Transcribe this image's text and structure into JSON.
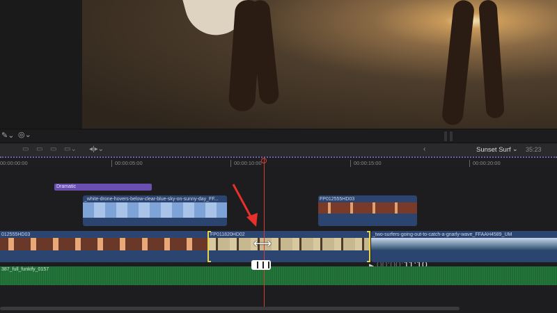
{
  "viewer": {
    "timecode_dim": "00:00:",
    "timecode_bright": "11:10"
  },
  "timeline": {
    "project_name": "Sunset Surf",
    "duration": "35:23",
    "ruler": [
      "00:00:00:00",
      "00:00:05:00",
      "00:00:10:00",
      "00:00:15:00",
      "00:00:20:00"
    ],
    "title_clip": "Dramatic",
    "connected_clips": [
      "_white-drone-hovers-below-clear-blue-sky-on-sunny-day_FF...",
      "FP012555HD03"
    ],
    "primary_clips": [
      "012555HD03",
      "FP011820HD02",
      "_two-surfers-going-out-to-catch-a-gnarly-wave_FFAAH4589_UM"
    ],
    "audio_clip": "387_full_funkify_0157"
  },
  "colors": {
    "playhead": "#d04030",
    "selection": "#e8d44a",
    "title": "#6b4fb0",
    "audio": "#237a3c",
    "clip": "#2b4470"
  }
}
